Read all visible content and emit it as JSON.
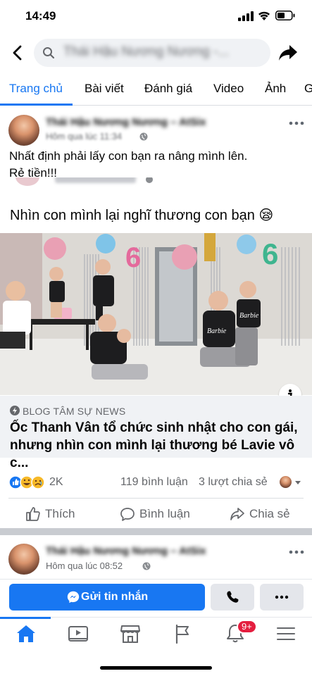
{
  "status_bar": {
    "time": "14:49"
  },
  "header": {
    "search_text": "Thái Hậu Nương Nương -..."
  },
  "tabs": [
    {
      "label": "Trang chủ",
      "active": true
    },
    {
      "label": "Bài viết"
    },
    {
      "label": "Đánh giá"
    },
    {
      "label": "Video"
    },
    {
      "label": "Ảnh"
    },
    {
      "label": "G"
    }
  ],
  "post": {
    "author_name": "Thái Hậu Nương Nương – AtSix",
    "time": "Hôm qua lúc 11:34",
    "text_line1": "Nhất định phải lấy con bạn ra nâng mình lên.",
    "text_line2": "Rẻ tiền!!!",
    "shared": {
      "text": "Nhìn con mình lại nghĩ thương con bạn 😪",
      "link_source": "BLOG TÂM SỰ NEWS",
      "link_title_line1": "Ốc Thanh Vân tổ chức sinh nhật cho con gái,",
      "link_title_line2": "nhưng nhìn con mình lại thương bé Lavie vô c..."
    },
    "stats": {
      "reactions": "2K",
      "comments": "119 bình luận",
      "shares": "3 lượt chia sẻ"
    },
    "actions": {
      "like": "Thích",
      "comment": "Bình luận",
      "share": "Chia sẻ"
    }
  },
  "post2": {
    "author_name": "Thái Hậu Nương Nương – AtSix",
    "time": "Hôm qua lúc 08:52"
  },
  "cta": {
    "message_label": "Gửi tin nhắn"
  },
  "bottom_nav": {
    "notifications_badge": "9+"
  },
  "colors": {
    "accent": "#1877f2",
    "badge": "#e41e3f",
    "muted": "#65676b"
  }
}
